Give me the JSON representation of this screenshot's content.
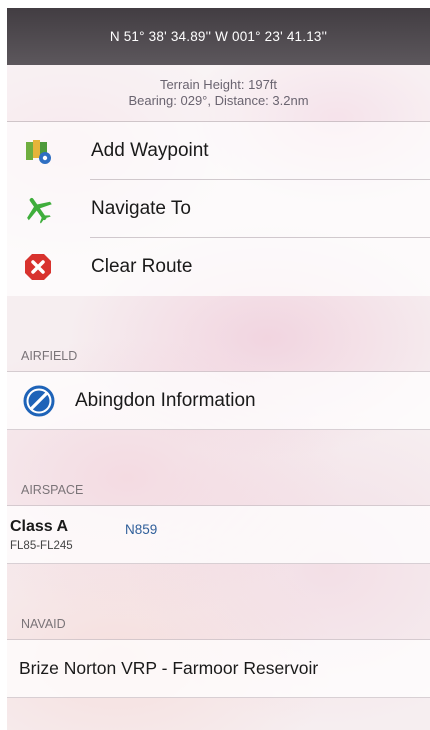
{
  "header": {
    "coordinates": "N 51° 38' 34.89'' W 001° 23' 41.13''",
    "terrain_height": "Terrain Height: 197ft",
    "bearing_distance": "Bearing: 029°, Distance: 3.2nm"
  },
  "actions": [
    {
      "label": "Add Waypoint",
      "icon": "map-waypoint-icon"
    },
    {
      "label": "Navigate To",
      "icon": "plane-icon"
    },
    {
      "label": "Clear Route",
      "icon": "clear-icon"
    }
  ],
  "airfield": {
    "header": "AIRFIELD",
    "item_label": "Abingdon Information",
    "icon": "no-entry-icon"
  },
  "airspace": {
    "header": "AIRSPACE",
    "class": "Class A",
    "levels": "FL85-FL245",
    "code": "N859"
  },
  "navaid": {
    "header": "NAVAID",
    "item_label": "Brize Norton VRP - Farmoor Reservoir"
  },
  "colors": {
    "header_bar": "#4d484d",
    "link_blue": "#2f5f9a",
    "clear_red": "#d8322e",
    "plane_green": "#3fae3c",
    "airfield_blue": "#1e63b8"
  }
}
